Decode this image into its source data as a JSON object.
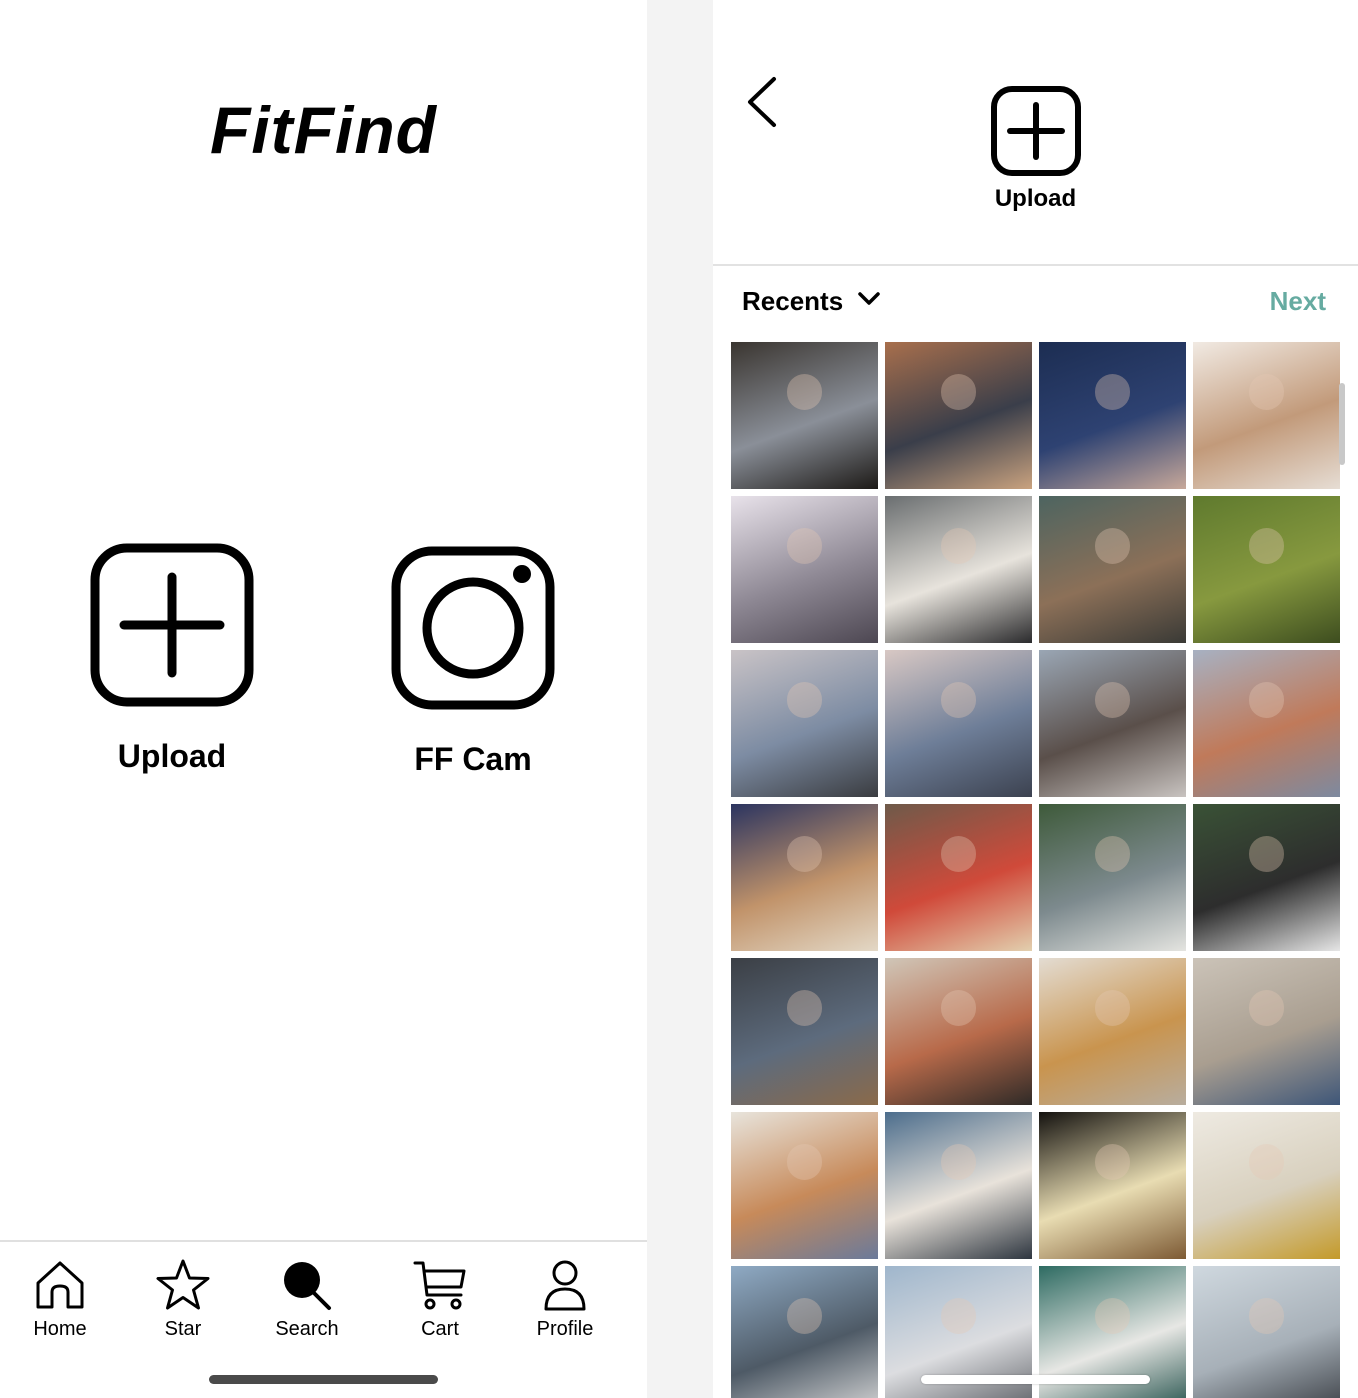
{
  "left_screen": {
    "app_title": "FitFind",
    "actions": {
      "upload_label": "Upload",
      "camera_label": "FF Cam"
    },
    "tabbar": {
      "home": "Home",
      "star": "Star",
      "search": "Search",
      "cart": "Cart",
      "profile": "Profile"
    }
  },
  "right_screen": {
    "header": {
      "icon": "plus-square-icon",
      "title": "Upload"
    },
    "album_selector": "Recents",
    "next_label": "Next",
    "accent_color": "#66aba1",
    "photos": [
      {
        "name": "photo-outfit-striped-skirt",
        "colors": [
          "#3a3530",
          "#8a8f98",
          "#1d1a17"
        ]
      },
      {
        "name": "photo-canal-portrait",
        "colors": [
          "#a86f4c",
          "#3a3e4a",
          "#c9a27f"
        ]
      },
      {
        "name": "photo-hand-blue",
        "colors": [
          "#1c2d52",
          "#2e4272",
          "#c7a89a"
        ]
      },
      {
        "name": "photo-splash-beach",
        "colors": [
          "#f1eae3",
          "#c29a7a",
          "#e6ddd4"
        ]
      },
      {
        "name": "photo-bridge-blur",
        "colors": [
          "#e8e2ea",
          "#8f8995",
          "#4d4752"
        ]
      },
      {
        "name": "photo-storefront",
        "colors": [
          "#6a6e70",
          "#e7e3dc",
          "#2b2b2d"
        ]
      },
      {
        "name": "photo-cafe-patio",
        "colors": [
          "#4d6460",
          "#8c7058",
          "#3a3a36"
        ]
      },
      {
        "name": "photo-rabbits-grass",
        "colors": [
          "#5f7a2e",
          "#87993f",
          "#3d4d1f"
        ]
      },
      {
        "name": "photo-rooftop-camera",
        "colors": [
          "#c9c3c6",
          "#7d8ca3",
          "#3a3c40"
        ]
      },
      {
        "name": "photo-rooftop-sunset",
        "colors": [
          "#d8c8c4",
          "#6e7e98",
          "#3c4250"
        ]
      },
      {
        "name": "photo-friends-camera",
        "colors": [
          "#9aa6b4",
          "#5a4f4a",
          "#c8c3c0"
        ]
      },
      {
        "name": "photo-pizza-girl",
        "colors": [
          "#a7b1c2",
          "#c07a5a",
          "#7d8aa0"
        ]
      },
      {
        "name": "photo-picnic-pizza",
        "colors": [
          "#2b3460",
          "#c1936a",
          "#e3d8c6"
        ]
      },
      {
        "name": "photo-record-player",
        "colors": [
          "#6e5a4a",
          "#d04a3a",
          "#e2cfae"
        ]
      },
      {
        "name": "photo-cap-portrait",
        "colors": [
          "#3e5a3a",
          "#7d8a8e",
          "#e4e4e0"
        ]
      },
      {
        "name": "photo-cap-donut",
        "colors": [
          "#3a5236",
          "#2d2d2d",
          "#e6e6e6"
        ]
      },
      {
        "name": "photo-attic-cap",
        "colors": [
          "#3b3f45",
          "#5d6b7d",
          "#8a6a4a"
        ]
      },
      {
        "name": "photo-pizza-lying",
        "colors": [
          "#d0c6b8",
          "#b86a4a",
          "#2f2a27"
        ]
      },
      {
        "name": "photo-bread-table",
        "colors": [
          "#e3dcd2",
          "#c9944e",
          "#b8ad9e"
        ]
      },
      {
        "name": "photo-cat-blanket",
        "colors": [
          "#cbc3b8",
          "#a99e90",
          "#3e5678"
        ]
      },
      {
        "name": "photo-graphic-tee",
        "colors": [
          "#e8e4dc",
          "#c78a5a",
          "#6b7a9a"
        ]
      },
      {
        "name": "photo-polaroid-camera",
        "colors": [
          "#4c6d8c",
          "#e8e2da",
          "#2e3640"
        ]
      },
      {
        "name": "photo-lanterns",
        "colors": [
          "#14120f",
          "#e8dcb2",
          "#7d5a34"
        ]
      },
      {
        "name": "photo-yellow-flower",
        "colors": [
          "#eeeae2",
          "#d8d0be",
          "#c49a2a"
        ]
      },
      {
        "name": "photo-japanese-castle",
        "colors": [
          "#8faac4",
          "#4e5a66",
          "#d7d7d7"
        ]
      },
      {
        "name": "photo-castle-blossom",
        "colors": [
          "#9fb6cc",
          "#dcdde0",
          "#5a5d63"
        ]
      },
      {
        "name": "photo-green-wall-pose",
        "colors": [
          "#2e6b62",
          "#e7e7e4",
          "#1f4e48"
        ]
      },
      {
        "name": "photo-street-pose",
        "colors": [
          "#cfd8df",
          "#a7b0b8",
          "#3a3e44"
        ]
      }
    ]
  }
}
